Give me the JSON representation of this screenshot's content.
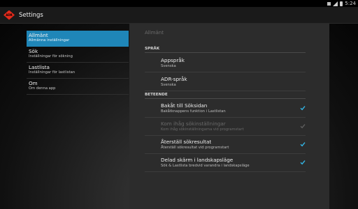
{
  "status_bar": {
    "time": "5:24"
  },
  "action_bar": {
    "logo_text": "ADR",
    "title": "Settings"
  },
  "headers": [
    {
      "title": "Allmänt",
      "summary": "Allmänna inställningar"
    },
    {
      "title": "Sök",
      "summary": "Inställningar för sökning"
    },
    {
      "title": "Lastlista",
      "summary": "Inställningar för lastlistan"
    },
    {
      "title": "Om",
      "summary": "Om denna app"
    }
  ],
  "pane": {
    "title": "Allmänt",
    "categories": {
      "language": "SPRÅK",
      "behavior": "BETEENDE"
    },
    "language_prefs": [
      {
        "title": "Appspråk",
        "summary": "Svenska"
      },
      {
        "title": "ADR-språk",
        "summary": "Svenska"
      }
    ],
    "behavior_prefs": [
      {
        "title": "Bakåt till Söksidan",
        "summary": "Bakåtknappens funktion i Lastlistan",
        "checked": true,
        "enabled": true
      },
      {
        "title": "Kom ihåg sökinställningar",
        "summary": "Kom ihåg sökinställningarna vid programstart",
        "checked": true,
        "enabled": false
      },
      {
        "title": "Återställ sökresultat",
        "summary": "Återställ sökresultat vid programstart",
        "checked": true,
        "enabled": true
      },
      {
        "title": "Delad skärm i landskapsläge",
        "summary": "Sök & Lastlista bredvid varandra i landskapsläge",
        "checked": true,
        "enabled": true
      }
    ]
  },
  "colors": {
    "accent": "#1f86b8",
    "check": "#33b5e5",
    "logo": "#e52b1c"
  }
}
